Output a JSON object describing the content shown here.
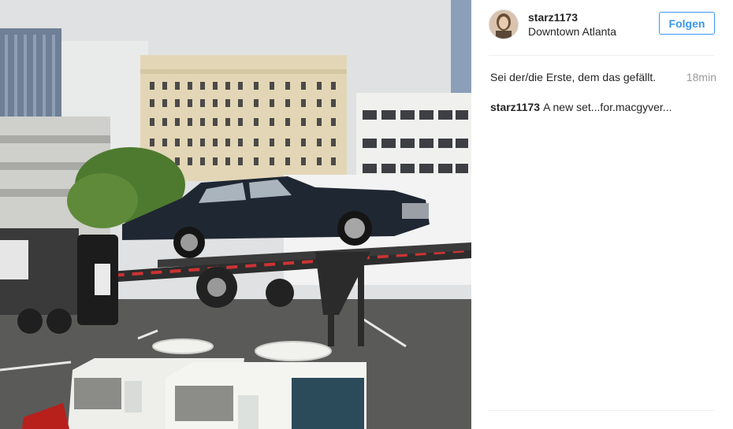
{
  "post": {
    "image_alt": "Car on a trailer in a downtown parking lot"
  },
  "header": {
    "username": "starz1173",
    "location": "Downtown Atlanta",
    "follow_label": "Folgen"
  },
  "likes": {
    "prefix": "Sei der/die Erste, dem ",
    "link_word": "das",
    "suffix": " gefällt.",
    "time_ago": "18min"
  },
  "caption": {
    "author": "starz1173",
    "text": "A new set...for.macgyver..."
  },
  "colors": {
    "accent": "#3897f0",
    "text": "#262626",
    "muted": "#999999",
    "divider": "#efefef"
  }
}
